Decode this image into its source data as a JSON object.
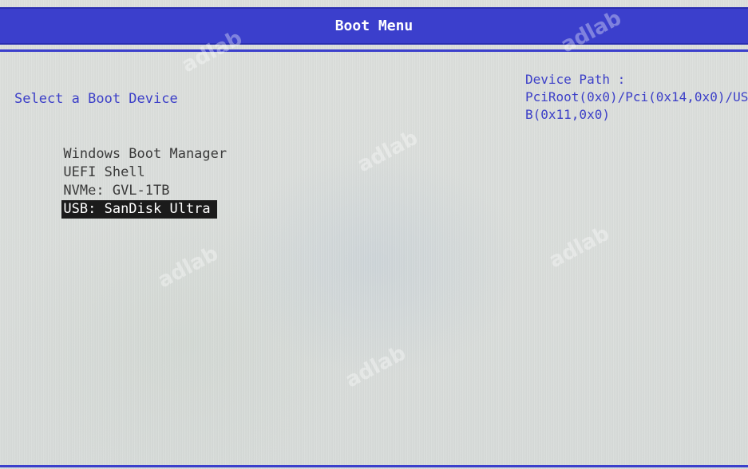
{
  "header": {
    "title": "Boot Menu"
  },
  "menu": {
    "heading": "Select a Boot Device",
    "items": [
      {
        "label": "Windows Boot Manager",
        "selected": false
      },
      {
        "label": "UEFI Shell",
        "selected": false
      },
      {
        "label": "NVMe: GVL-1TB",
        "selected": false
      },
      {
        "label": "USB: SanDisk Ultra",
        "selected": true
      }
    ]
  },
  "info": {
    "label": "Device Path :",
    "value_line1": "PciRoot(0x0)/Pci(0x14,0x0)/US",
    "value_line2": "B(0x11,0x0)"
  },
  "watermark": "adlab",
  "colors": {
    "title_bar": "#3b3fcc",
    "accent_text": "#3d40c8",
    "background": "#d9dcda",
    "selection": "#1b1b1b"
  }
}
